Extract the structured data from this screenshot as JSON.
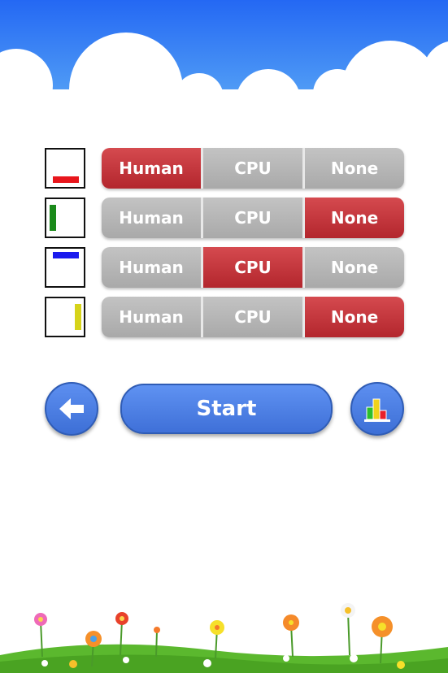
{
  "players": [
    {
      "color": "#e8161c",
      "selected": "Human",
      "options": [
        "Human",
        "CPU",
        "None"
      ]
    },
    {
      "color": "#1a8a1a",
      "selected": "None",
      "options": [
        "Human",
        "CPU",
        "None"
      ]
    },
    {
      "color": "#1a1aee",
      "selected": "CPU",
      "options": [
        "Human",
        "CPU",
        "None"
      ]
    },
    {
      "color": "#d6d31a",
      "selected": "None",
      "options": [
        "Human",
        "CPU",
        "None"
      ]
    }
  ],
  "controls": {
    "start_label": "Start",
    "back_icon": "back-arrow-icon",
    "stats_icon": "bar-chart-icon"
  },
  "colors": {
    "active_segment": "#c0323a",
    "inactive_segment": "#b3b3b3",
    "button_blue": "#4a7fe6",
    "sky_blue": "#2a6ff2"
  }
}
